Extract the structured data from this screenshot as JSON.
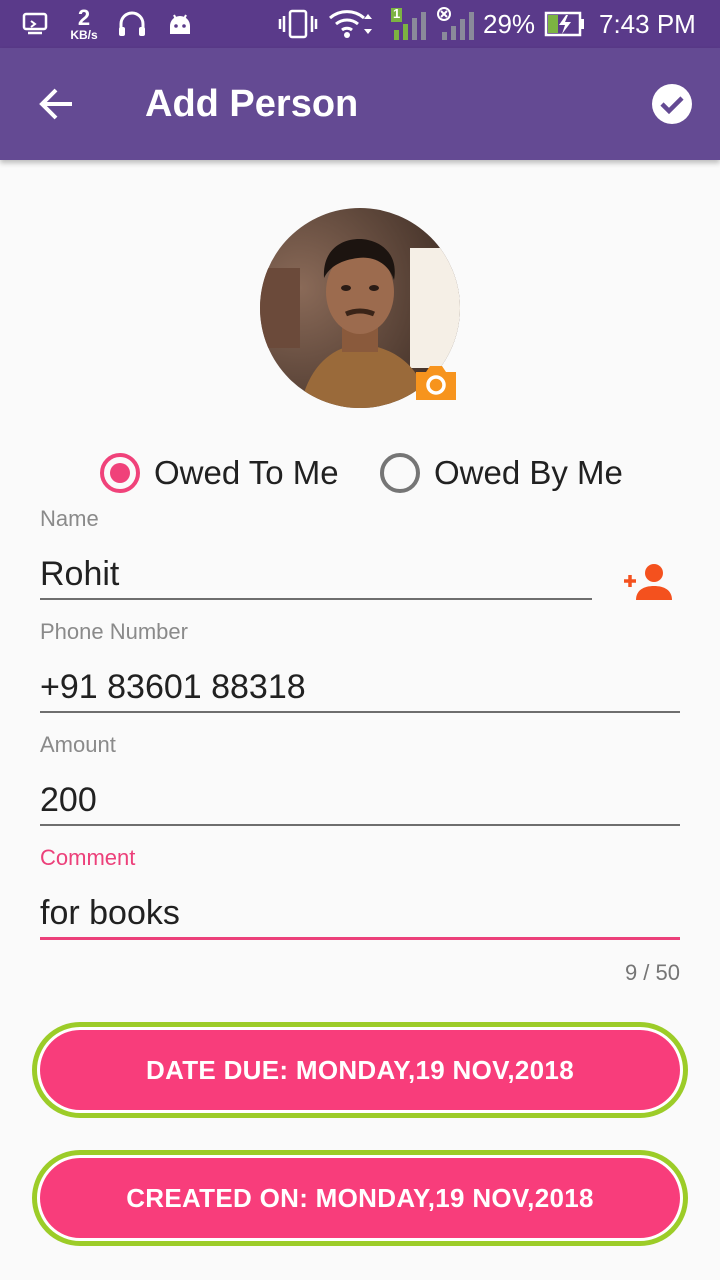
{
  "status_bar": {
    "speed_value": "2",
    "speed_unit": "KB/s",
    "sim_number": "1",
    "battery_percent": "29%",
    "time": "7:43 PM",
    "icons": [
      "screen-cast-icon",
      "headset-icon",
      "android-icon",
      "vibrate-icon",
      "wifi-icon",
      "signal-icon",
      "signal-no-sim-icon",
      "battery-charging-icon"
    ]
  },
  "app_bar": {
    "title": "Add Person",
    "back_icon": "arrow-back-icon",
    "save_icon": "check-circle-icon",
    "background": "#644a93"
  },
  "avatar": {
    "camera_icon": "camera-icon",
    "camera_color": "#f7941d"
  },
  "debt_type": {
    "options": [
      {
        "label": "Owed To Me",
        "selected": true
      },
      {
        "label": "Owed By Me",
        "selected": false
      }
    ],
    "accent": "#f0427a"
  },
  "form": {
    "name": {
      "label": "Name",
      "value": "Rohit"
    },
    "phone": {
      "label": "Phone Number",
      "value": "+91 83601 88318"
    },
    "amount": {
      "label": "Amount",
      "value": "200"
    },
    "comment": {
      "label": "Comment",
      "value": "for books",
      "counter": "9 / 50"
    }
  },
  "buttons": {
    "date_due": "DATE DUE: MONDAY,19 NOV,2018",
    "created_on": "CREATED ON: MONDAY,19 NOV,2018",
    "button_color": "#f83d7b",
    "border_color": "#9ccc28"
  }
}
